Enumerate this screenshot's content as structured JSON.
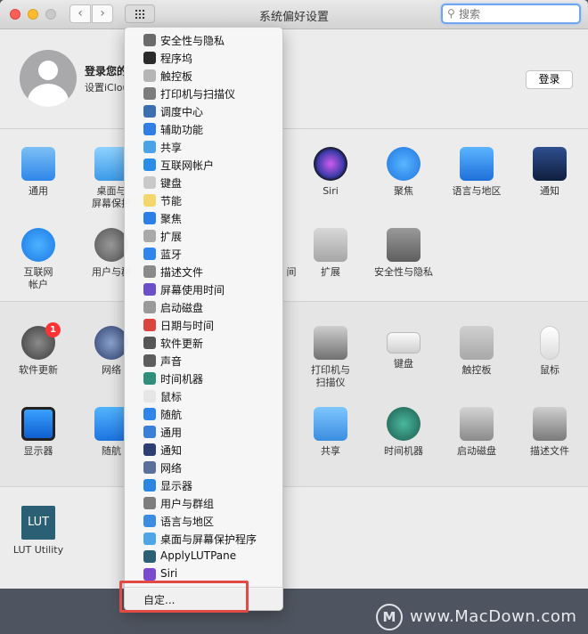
{
  "window": {
    "title": "系统偏好设置",
    "search_placeholder": "搜索"
  },
  "account": {
    "title": "登录您的",
    "subtitle": "设置iCloud",
    "login_label": "登录"
  },
  "sections": {
    "row1": [
      {
        "label": "通用",
        "icon": "general-icon"
      },
      {
        "label": "桌面与\n屏幕保护",
        "icon": "desktop-icon"
      },
      {
        "label": "Siri",
        "icon": "siri-icon"
      },
      {
        "label": "聚焦",
        "icon": "spotlight-icon"
      },
      {
        "label": "语言与地区",
        "icon": "language-icon"
      },
      {
        "label": "通知",
        "icon": "notifications-icon"
      }
    ],
    "row2": [
      {
        "label": "互联网\n帐户",
        "icon": "internet-accounts-icon"
      },
      {
        "label": "用户与群",
        "icon": "users-icon"
      },
      {
        "label": "间",
        "icon": "partial-icon"
      },
      {
        "label": "扩展",
        "icon": "extensions-icon"
      },
      {
        "label": "安全性与隐私",
        "icon": "security-icon"
      }
    ],
    "row3": [
      {
        "label": "软件更新",
        "icon": "software-update-icon",
        "badge": "1"
      },
      {
        "label": "网络",
        "icon": "network-icon"
      },
      {
        "label": "打印机与\n扫描仪",
        "icon": "printer-icon"
      },
      {
        "label": "键盘",
        "icon": "keyboard-icon"
      },
      {
        "label": "触控板",
        "icon": "trackpad-icon"
      },
      {
        "label": "鼠标",
        "icon": "mouse-icon"
      }
    ],
    "row4": [
      {
        "label": "显示器",
        "icon": "display-icon"
      },
      {
        "label": "随航",
        "icon": "sidecar-icon"
      },
      {
        "label": "共享",
        "icon": "sharing-icon"
      },
      {
        "label": "时间机器",
        "icon": "time-machine-icon"
      },
      {
        "label": "启动磁盘",
        "icon": "startup-disk-icon"
      },
      {
        "label": "描述文件",
        "icon": "profiles-icon"
      }
    ],
    "row5": [
      {
        "label": "LUT Utility",
        "icon": "lut-utility-icon",
        "icon_text": "LUT"
      }
    ]
  },
  "menu": {
    "items": [
      {
        "label": "安全性与隐私",
        "color": "#6b6b6b"
      },
      {
        "label": "程序坞",
        "color": "#2b2b2b"
      },
      {
        "label": "触控板",
        "color": "#b5b5b5"
      },
      {
        "label": "打印机与扫描仪",
        "color": "#7c7c7c"
      },
      {
        "label": "调度中心",
        "color": "#3b6fb0"
      },
      {
        "label": "辅助功能",
        "color": "#2f7ee6"
      },
      {
        "label": "共享",
        "color": "#4aa3e6"
      },
      {
        "label": "互联网帐户",
        "color": "#2a8de8"
      },
      {
        "label": "键盘",
        "color": "#c9c9c9"
      },
      {
        "label": "节能",
        "color": "#f2d86a"
      },
      {
        "label": "聚焦",
        "color": "#2d7fe8"
      },
      {
        "label": "扩展",
        "color": "#a9a9a9"
      },
      {
        "label": "蓝牙",
        "color": "#2f86ea"
      },
      {
        "label": "描述文件",
        "color": "#8a8a8a"
      },
      {
        "label": "屏幕使用时间",
        "color": "#6a4fc8"
      },
      {
        "label": "启动磁盘",
        "color": "#9a9a9a"
      },
      {
        "label": "日期与时间",
        "color": "#d9453e"
      },
      {
        "label": "软件更新",
        "color": "#555555"
      },
      {
        "label": "声音",
        "color": "#5d5d5d"
      },
      {
        "label": "时间机器",
        "color": "#2f8f7a"
      },
      {
        "label": "鼠标",
        "color": "#e6e6e6"
      },
      {
        "label": "随航",
        "color": "#2f86ea"
      },
      {
        "label": "通用",
        "color": "#3a7fd8"
      },
      {
        "label": "通知",
        "color": "#2b3f73"
      },
      {
        "label": "网络",
        "color": "#5a6f9a"
      },
      {
        "label": "显示器",
        "color": "#2a86e0"
      },
      {
        "label": "用户与群组",
        "color": "#7d7d7d"
      },
      {
        "label": "语言与地区",
        "color": "#3a8de0"
      },
      {
        "label": "桌面与屏幕保护程序",
        "color": "#4fa6e6"
      },
      {
        "label": "ApplyLUTPane",
        "color": "#2b5f74"
      },
      {
        "label": "Siri",
        "color": "#7a4ad0"
      }
    ],
    "customize_label": "自定..."
  },
  "watermark": {
    "text": "www.MacDown.com",
    "logo": "M"
  }
}
